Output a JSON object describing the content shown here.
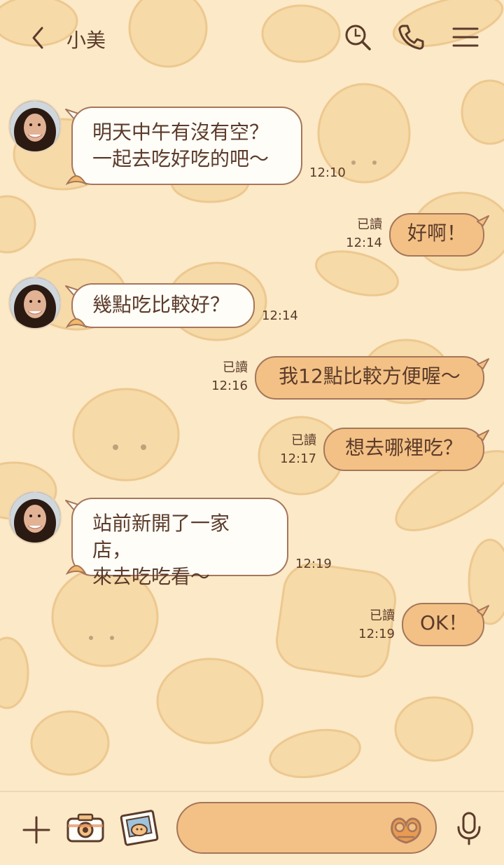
{
  "header": {
    "contact_name": "小美",
    "icons": [
      "back-chevron-icon",
      "search-icon",
      "phone-icon",
      "menu-icon"
    ]
  },
  "messages": [
    {
      "direction": "in",
      "text": "明天中午有沒有空？\n一起去吃好吃的吧～",
      "time": "12:10"
    },
    {
      "direction": "out",
      "text": "好啊！",
      "read": "已讀",
      "time": "12:14"
    },
    {
      "direction": "in",
      "text": "幾點吃比較好？",
      "time": "12:14"
    },
    {
      "direction": "out",
      "text": "我12點比較方便喔～",
      "read": "已讀",
      "time": "12:16"
    },
    {
      "direction": "out",
      "text": "想去哪裡吃？",
      "read": "已讀",
      "time": "12:17"
    },
    {
      "direction": "in",
      "text": "站前新開了一家店，\n來去吃吃看～",
      "time": "12:19"
    },
    {
      "direction": "out",
      "text": "OK！",
      "read": "已讀",
      "time": "12:19"
    }
  ],
  "footer": {
    "icons": [
      "plus-icon",
      "camera-icon",
      "photo-icon",
      "pretzel-sticker-icon",
      "microphone-icon"
    ],
    "input_value": ""
  },
  "colors": {
    "background": "#fbe9c8",
    "incoming_bubble": "#fffdf8",
    "outgoing_bubble": "#f3c185",
    "bubble_border": "#a6765a",
    "text": "#5b3b2a",
    "icon": "#5b3b2a"
  }
}
